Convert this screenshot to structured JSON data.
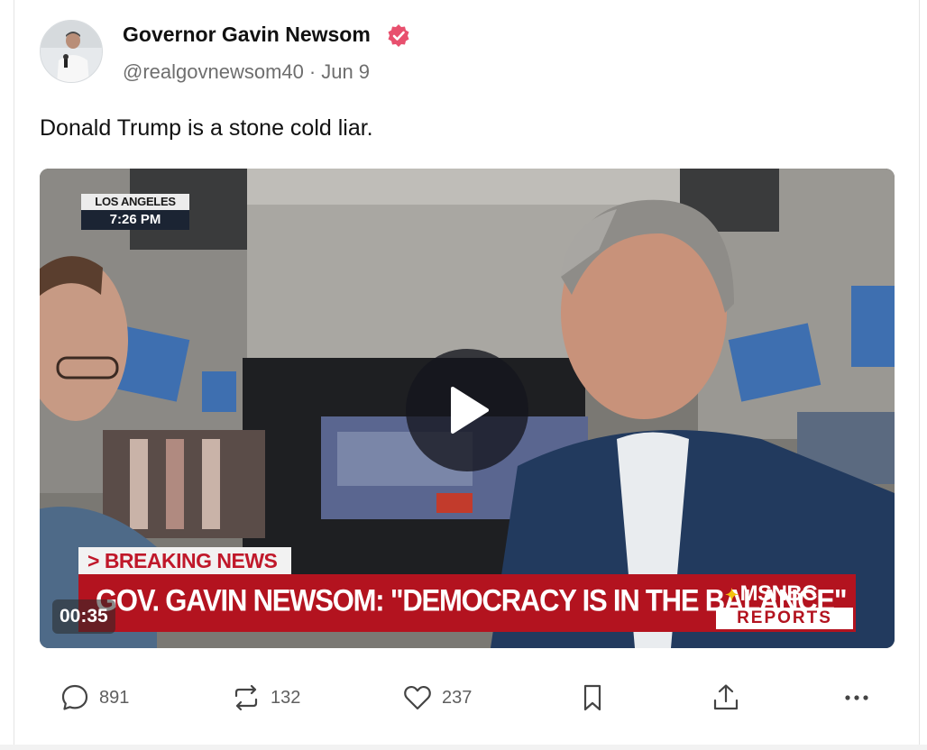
{
  "post": {
    "author_name": "Governor Gavin Newsom",
    "handle": "@realgovnewsom40",
    "separator": "·",
    "date": "Jun 9",
    "text": "Donald Trump is a stone cold liar."
  },
  "video": {
    "location": "LOS ANGELES",
    "time": "7:26 PM",
    "breaking_label": "> BREAKING NEWS",
    "headline": "GOV. GAVIN NEWSOM: \"DEMOCRACY IS IN THE BALANCE\"",
    "network": "MSNBC",
    "network_sub": "REPORTS",
    "duration": "00:35"
  },
  "actions": {
    "replies": "891",
    "reposts": "132",
    "likes": "237"
  },
  "colors": {
    "verified": "#e8506e",
    "breaking_red": "#b3131f",
    "muted_text": "#6e6e6e"
  },
  "icons": {
    "verified": "verified-badge-icon",
    "reply": "speech-bubble-icon",
    "repost": "repost-arrows-icon",
    "like": "heart-icon",
    "bookmark": "bookmark-icon",
    "share": "share-upload-icon",
    "more": "more-dots-icon",
    "play": "play-icon"
  }
}
